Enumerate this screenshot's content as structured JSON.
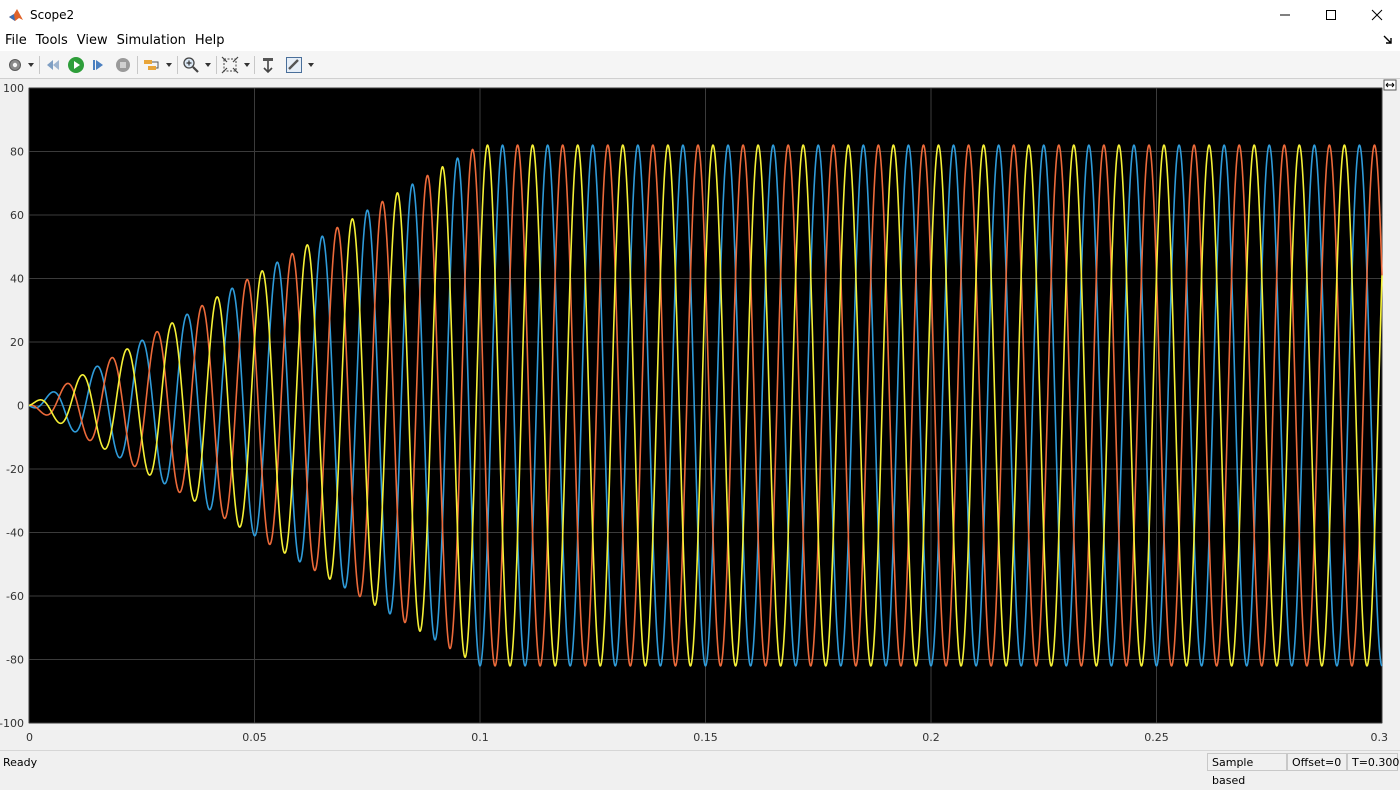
{
  "window": {
    "title": "Scope2"
  },
  "menu": [
    "File",
    "Tools",
    "View",
    "Simulation",
    "Help"
  ],
  "toolbar": {
    "buttons": [
      "settings-gear-icon",
      "dropdown-arrow-icon",
      "step-back-icon",
      "run-icon",
      "step-forward-icon",
      "stop-icon",
      "highlight-simulink-block-icon",
      "dropdown-arrow-icon",
      "zoom-in-icon",
      "dropdown-arrow-icon",
      "autoscale-icon",
      "dropdown-arrow-icon",
      "lock-axes-icon",
      "measurements-icon",
      "dropdown-arrow-icon"
    ]
  },
  "status": {
    "ready": "Ready",
    "sample_mode": "Sample based",
    "offset": "Offset=0",
    "time": "T=0.300"
  },
  "colors": {
    "plot_background": "#000000",
    "grid": "#3b3b3b",
    "series_blue": "#2f9bd9",
    "series_orange": "#ec6a3a",
    "series_yellow": "#f5f036"
  },
  "chart_data": {
    "type": "line",
    "title": "",
    "xlabel": "",
    "ylabel": "",
    "xlim": [
      0,
      0.3
    ],
    "ylim": [
      -100,
      100
    ],
    "x_ticks": [
      0,
      0.05,
      0.1,
      0.15,
      0.2,
      0.25,
      0.3
    ],
    "x_tick_labels": [
      "0",
      "0.05",
      "0.1",
      "0.15",
      "0.2",
      "0.25",
      "0.3"
    ],
    "y_ticks": [
      100,
      80,
      60,
      40,
      20,
      0,
      -20,
      -40,
      -60,
      -80,
      -100
    ],
    "y_tick_labels": [
      "100",
      "80",
      "60",
      "40",
      "20",
      "0",
      "-20",
      "-40",
      "-60",
      "-80",
      "-100"
    ],
    "grid": true,
    "legend": "none",
    "frequency_hz": 100,
    "steady_amplitude": 82,
    "ramp_end_time": 0.1,
    "series": [
      {
        "color": "#2f9bd9",
        "phase_deg": -90,
        "peaks": [
          [
            0.0133,
            11
          ],
          [
            0.0333,
            30
          ],
          [
            0.0533,
            47
          ],
          [
            0.0733,
            63
          ],
          [
            0.0933,
            77
          ],
          [
            0.1033,
            81
          ],
          [
            0.15,
            82
          ],
          [
            0.25,
            82
          ],
          [
            0.2933,
            82
          ]
        ]
      },
      {
        "color": "#ec6a3a",
        "phase_deg": 150,
        "peaks": [
          [
            0.02,
            17
          ],
          [
            0.04,
            35
          ],
          [
            0.06,
            52
          ],
          [
            0.08,
            67
          ],
          [
            0.1,
            79
          ],
          [
            0.11,
            82
          ],
          [
            0.2,
            82
          ],
          [
            0.3,
            82
          ]
        ]
      },
      {
        "color": "#f5f036",
        "phase_deg": 30,
        "peaks": [
          [
            0.0067,
            6
          ],
          [
            0.0267,
            25
          ],
          [
            0.0467,
            43
          ],
          [
            0.0667,
            59
          ],
          [
            0.0867,
            74
          ],
          [
            0.1067,
            82
          ],
          [
            0.1467,
            83
          ],
          [
            0.2467,
            82
          ]
        ]
      }
    ]
  }
}
